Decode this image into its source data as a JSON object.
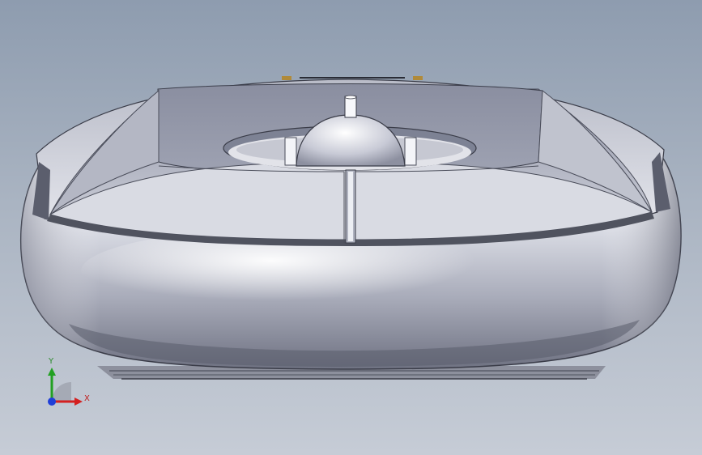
{
  "viewport": {
    "background_top": "#8e9caf",
    "background_bottom": "#c6ccd6"
  },
  "model": {
    "icon": "mouse-housing-3d-model",
    "body_color": "#d8dbe4",
    "cavity_color": "#7d8294"
  },
  "triad": {
    "icon": "coordinate-triad-icon",
    "y_label": "Y",
    "x_label": "X",
    "x_color": "#d42020",
    "y_color": "#22a022",
    "z_color": "#1f3fd8"
  }
}
